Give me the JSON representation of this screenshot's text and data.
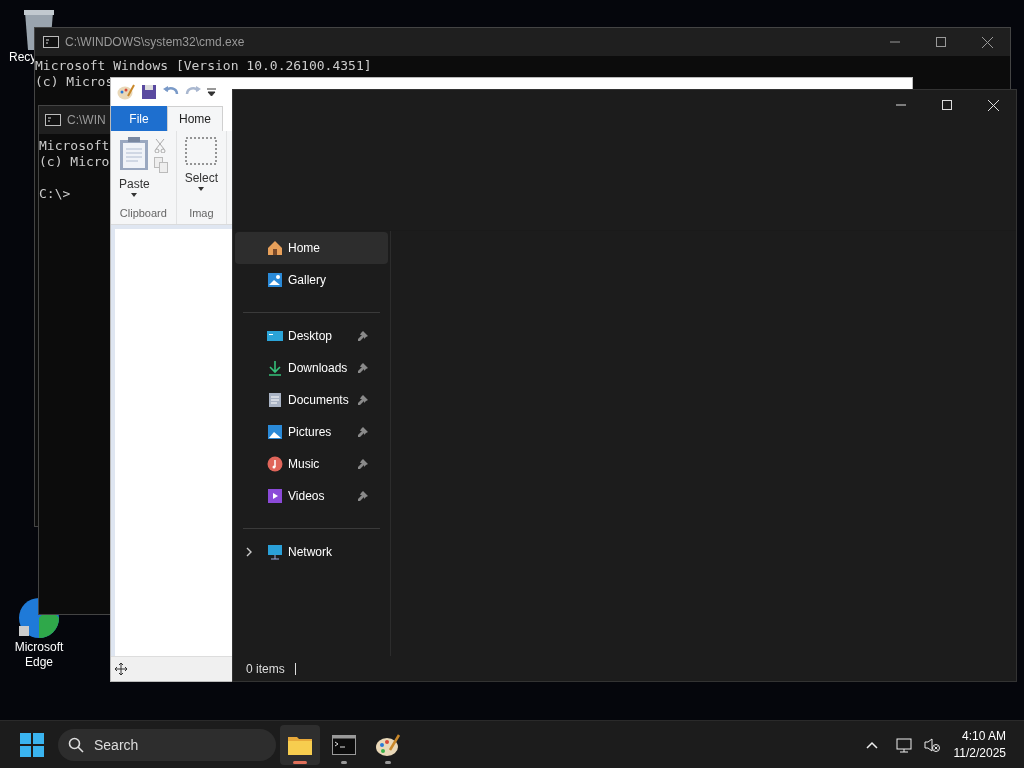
{
  "desktop_icons": [
    {
      "label": "Recy"
    },
    {
      "label": "Microsoft Edge"
    }
  ],
  "cmd_windows": [
    {
      "title": "C:\\WINDOWS\\system32\\cmd.exe",
      "lines": [
        "Microsoft Windows [Version 10.0.26100.4351]",
        "(c) Micros"
      ]
    },
    {
      "title": "C:\\WIN",
      "lines": [
        "Microsoft",
        "(c) Micro"
      ],
      "prompt": "C:\\>"
    }
  ],
  "paint": {
    "tabs": [
      {
        "label": "File",
        "kind": "file",
        "selected": false
      },
      {
        "label": "Home",
        "kind": "tab",
        "selected": true
      }
    ],
    "groups": [
      {
        "label": "Clipboard",
        "tool": "Paste"
      },
      {
        "label": "Imag",
        "tool": "Select"
      }
    ]
  },
  "explorer": {
    "nav": [
      [
        {
          "label": "Home",
          "kind": "home",
          "selected": true,
          "pinned": false
        },
        {
          "label": "Gallery",
          "kind": "gallery",
          "selected": false,
          "pinned": false
        }
      ],
      [
        {
          "label": "Desktop",
          "kind": "desktop",
          "selected": false,
          "pinned": true
        },
        {
          "label": "Downloads",
          "kind": "downloads",
          "selected": false,
          "pinned": true
        },
        {
          "label": "Documents",
          "kind": "documents",
          "selected": false,
          "pinned": true
        },
        {
          "label": "Pictures",
          "kind": "pictures",
          "selected": false,
          "pinned": true
        },
        {
          "label": "Music",
          "kind": "music",
          "selected": false,
          "pinned": true
        },
        {
          "label": "Videos",
          "kind": "videos",
          "selected": false,
          "pinned": true
        }
      ],
      [
        {
          "label": "Network",
          "kind": "network",
          "selected": false,
          "pinned": false,
          "expanded": false
        }
      ]
    ],
    "status": "0 items"
  },
  "taskbar": {
    "search": {
      "placeholder": "Search"
    },
    "apps": [
      {
        "kind": "folder",
        "active": true
      },
      {
        "kind": "terminal",
        "active": false
      },
      {
        "kind": "paint",
        "active": false
      }
    ],
    "time": "4:10 AM",
    "date": "11/2/2025"
  }
}
